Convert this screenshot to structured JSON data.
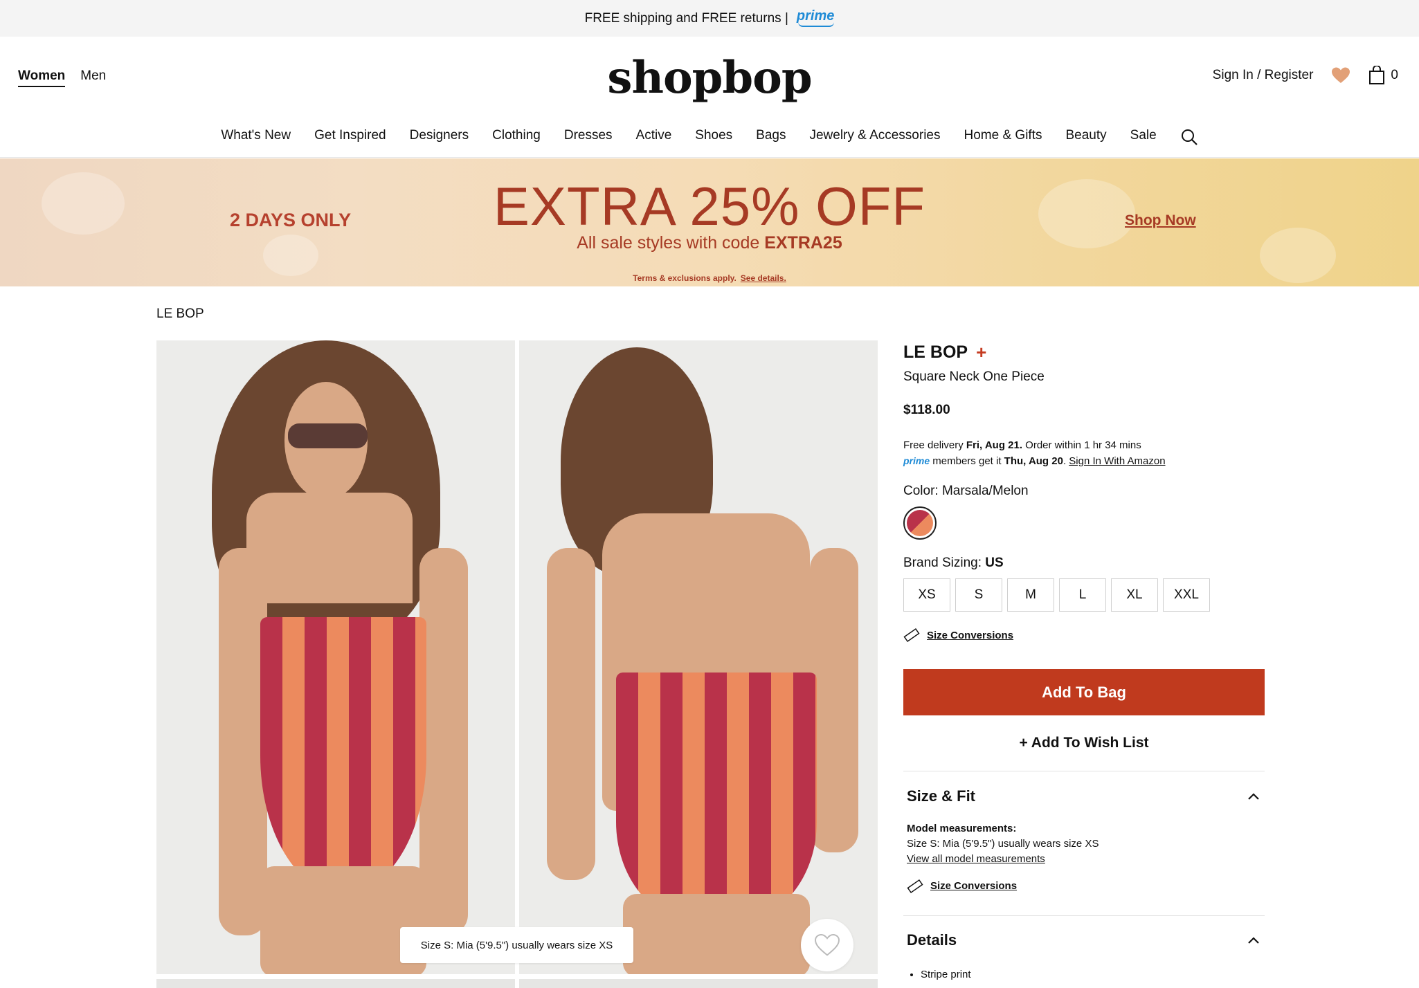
{
  "topbar": {
    "text": "FREE shipping and FREE returns |",
    "prime": "prime"
  },
  "header": {
    "gender": [
      "Women",
      "Men"
    ],
    "logo": "shopbop",
    "signin": "Sign In / Register",
    "bag_count": "0"
  },
  "nav": [
    "What's New",
    "Get Inspired",
    "Designers",
    "Clothing",
    "Dresses",
    "Active",
    "Shoes",
    "Bags",
    "Jewelry & Accessories",
    "Home & Gifts",
    "Beauty",
    "Sale"
  ],
  "promo": {
    "days": "2 DAYS ONLY",
    "headline": "EXTRA 25% OFF",
    "sub_prefix": "All sale styles with code ",
    "code": "EXTRA25",
    "terms": "Terms & exclusions apply.",
    "see_details": "See details.",
    "shop_now": "Shop Now"
  },
  "breadcrumb": "LE BOP",
  "gallery": {
    "caption": "Size S: Mia (5'9.5\") usually wears size XS"
  },
  "product": {
    "brand": "LE BOP",
    "brand_plus": "+",
    "name": "Square Neck One Piece",
    "price": "$118.00",
    "delivery_prefix": "Free delivery ",
    "delivery_date": "Fri, Aug 21.",
    "delivery_suffix": " Order within 1 hr 34 mins",
    "prime_label": "prime",
    "prime_text": " members get it ",
    "prime_date": "Thu, Aug 20",
    "prime_signin": "Sign In With Amazon",
    "color_label": "Color: Marsala/Melon",
    "sizing_label": "Brand Sizing: ",
    "sizing_value": "US",
    "sizes": [
      "XS",
      "S",
      "M",
      "L",
      "XL",
      "XXL"
    ],
    "size_conversions": "Size Conversions",
    "add_to_bag": "Add To Bag",
    "add_to_wish": "+ Add To Wish List",
    "swatch_colors": [
      "#b9324a",
      "#ec8a5e"
    ]
  },
  "size_fit": {
    "title": "Size & Fit",
    "model_label": "Model measurements:",
    "model_text": "Size S: Mia (5'9.5\") usually wears size XS",
    "view_all": "View all model measurements",
    "size_conversions": "Size Conversions"
  },
  "details": {
    "title": "Details",
    "items": [
      "Stripe print"
    ]
  },
  "colors": {
    "accent": "#c03a1e",
    "promo_text": "#a63a24",
    "prime_blue": "#1f8bd6"
  }
}
